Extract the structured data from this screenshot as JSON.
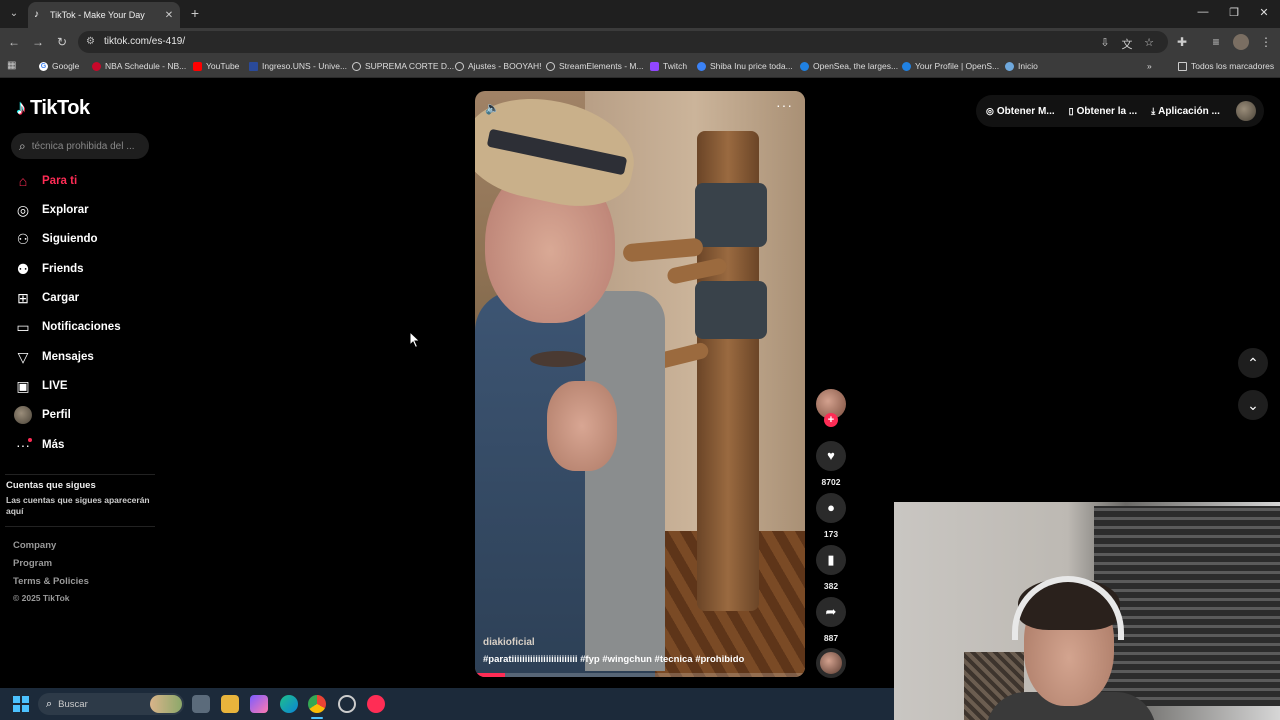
{
  "browser": {
    "tab_title": "TikTok - Make Your Day",
    "url": "tiktok.com/es-419/",
    "bookmarks": [
      {
        "label": "Google",
        "color": "#ffffff"
      },
      {
        "label": "NBA Schedule - NB...",
        "color": "#c9082a"
      },
      {
        "label": "YouTube",
        "color": "#ff0000"
      },
      {
        "label": "Ingreso.UNS - Unive...",
        "color": "#2a4a9a"
      },
      {
        "label": "SUPREMA CORTE D...",
        "color": "#cccccc"
      },
      {
        "label": "Ajustes - BOOYAH!",
        "color": "#cccccc"
      },
      {
        "label": "StreamElements - M...",
        "color": "#cccccc"
      },
      {
        "label": "Twitch",
        "color": "#9146ff"
      },
      {
        "label": "Shiba Inu price toda...",
        "color": "#3b82f6"
      },
      {
        "label": "OpenSea, the larges...",
        "color": "#2081e2"
      },
      {
        "label": "Your Profile | OpenS...",
        "color": "#2081e2"
      },
      {
        "label": "Inicio",
        "color": "#6fa8dc"
      }
    ],
    "all_bookmarks": "Todos los marcadores"
  },
  "tiktok": {
    "logo": "TikTok",
    "search_placeholder": "técnica prohibida del ...",
    "nav": [
      {
        "label": "Para ti",
        "icon": "home-icon"
      },
      {
        "label": "Explorar",
        "icon": "compass-icon"
      },
      {
        "label": "Siguiendo",
        "icon": "following-icon"
      },
      {
        "label": "Friends",
        "icon": "friends-icon"
      },
      {
        "label": "Cargar",
        "icon": "upload-icon"
      },
      {
        "label": "Notificaciones",
        "icon": "notifications-icon"
      },
      {
        "label": "Mensajes",
        "icon": "messages-icon"
      },
      {
        "label": "LIVE",
        "icon": "live-icon"
      },
      {
        "label": "Perfil",
        "icon": "profile-avatar"
      },
      {
        "label": "Más",
        "icon": "more-icon"
      }
    ],
    "following_title": "Cuentas que sigues",
    "following_desc": "Las cuentas que sigues aparecerán aquí",
    "footer": [
      "Company",
      "Program",
      "Terms & Policies"
    ],
    "copyright": "© 2025 TikTok",
    "top_right": {
      "coins": "Obtener M...",
      "app": "Obtener la ...",
      "download": "Aplicación ..."
    },
    "video": {
      "author": "diakioficial",
      "caption": "#paratiiiiiiiiiiiiiiiiiiiiiiiii #fyp #wingchun #tecnica #prohibido",
      "progress_percent": 9
    },
    "actions": {
      "likes": "8702",
      "comments": "173",
      "saves": "382",
      "shares": "887"
    }
  },
  "taskbar": {
    "search_placeholder": "Buscar"
  },
  "colors": {
    "accent": "#fe2c55",
    "page_bg": "#000000"
  }
}
